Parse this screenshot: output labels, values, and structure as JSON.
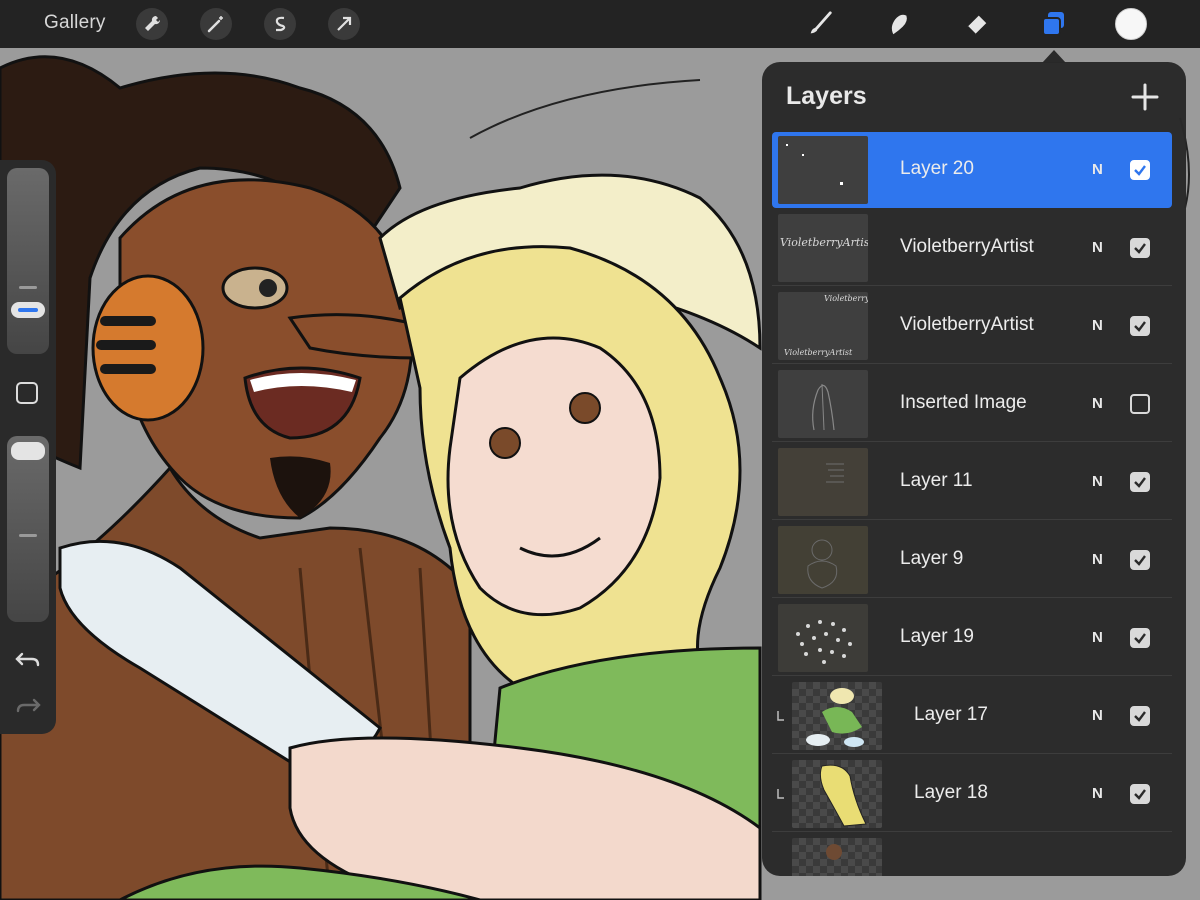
{
  "topbar": {
    "gallery_label": "Gallery",
    "tools_left": [
      "wrench-icon",
      "magic-wand-icon",
      "selection-s-icon",
      "transform-arrow-icon"
    ],
    "tools_right": [
      "brush-icon",
      "smudge-icon",
      "eraser-icon",
      "layers-icon"
    ],
    "active_tool": "layers-icon",
    "color": "#f7f7f7"
  },
  "layers_panel": {
    "title": "Layers",
    "add_icon": "plus-icon",
    "accent": "#2f76ee",
    "layers": [
      {
        "name": "Layer 20",
        "blend": "N",
        "visible": true,
        "selected": true,
        "clipped": false
      },
      {
        "name": "VioletberryArtist",
        "blend": "N",
        "visible": true,
        "selected": false,
        "clipped": false,
        "thumb_text": "VioletberryArtist"
      },
      {
        "name": "VioletberryArtist",
        "blend": "N",
        "visible": true,
        "selected": false,
        "clipped": false,
        "thumb_text_top": "Violetberry",
        "thumb_text_bottom": "VioletberryArtist"
      },
      {
        "name": "Inserted Image",
        "blend": "N",
        "visible": false,
        "selected": false,
        "clipped": false
      },
      {
        "name": "Layer 11",
        "blend": "N",
        "visible": true,
        "selected": false,
        "clipped": false
      },
      {
        "name": "Layer 9",
        "blend": "N",
        "visible": true,
        "selected": false,
        "clipped": false
      },
      {
        "name": "Layer 19",
        "blend": "N",
        "visible": true,
        "selected": false,
        "clipped": false
      },
      {
        "name": "Layer 17",
        "blend": "N",
        "visible": true,
        "selected": false,
        "clipped": true
      },
      {
        "name": "Layer 18",
        "blend": "N",
        "visible": true,
        "selected": false,
        "clipped": true
      }
    ]
  },
  "sidebar": {
    "icons": [
      "brush-size-slider",
      "modify-square-icon",
      "opacity-slider",
      "undo-icon",
      "redo-icon"
    ]
  }
}
